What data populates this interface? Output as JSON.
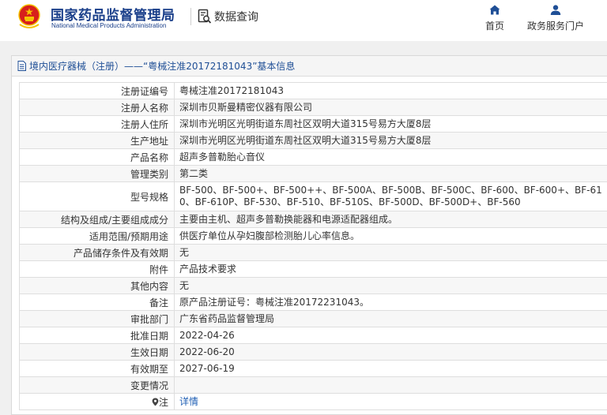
{
  "header": {
    "site_title_cn": "国家药品监督管理局",
    "site_title_en": "National Medical Products Administration",
    "data_query_label": "数据查询",
    "nav": [
      {
        "label": "首页",
        "icon": "home-icon"
      },
      {
        "label": "政务服务门户",
        "icon": "user-icon"
      }
    ]
  },
  "panel": {
    "title": "境内医疗器械（注册）——“粤械注准20172181043”基本信息"
  },
  "record": {
    "reg_no": {
      "label": "注册证编号",
      "value": "粤械注准20172181043"
    },
    "registrant": {
      "label": "注册人名称",
      "value": "深圳市贝斯曼精密仪器有限公司"
    },
    "registrant_address": {
      "label": "注册人住所",
      "value": "深圳市光明区光明街道东周社区双明大道315号易方大厦8层"
    },
    "production_address": {
      "label": "生产地址",
      "value": "深圳市光明区光明街道东周社区双明大道315号易方大厦8层"
    },
    "product_name": {
      "label": "产品名称",
      "value": "超声多普勒胎心音仪"
    },
    "category": {
      "label": "管理类别",
      "value": "第二类"
    },
    "models": {
      "label": "型号规格",
      "value": "BF-500、BF-500+、BF-500++、BF-500A、BF-500B、BF-500C、BF-600、BF-600+、BF-610、BF-610P、BF-530、BF-510、BF-510S、BF-500D、BF-500D+、BF-560"
    },
    "composition": {
      "label": "结构及组成/主要组成成分",
      "value": "主要由主机、超声多普勒换能器和电源适配器组成。"
    },
    "scope": {
      "label": "适用范围/预期用途",
      "value": "供医疗单位从孕妇腹部检测胎儿心率信息。"
    },
    "storage": {
      "label": "产品储存条件及有效期",
      "value": "无"
    },
    "attachment": {
      "label": "附件",
      "value": "产品技术要求"
    },
    "other": {
      "label": "其他内容",
      "value": "无"
    },
    "remark": {
      "label": "备注",
      "value": "原产品注册证号：粤械注准20172231043。"
    },
    "approval_dept": {
      "label": "审批部门",
      "value": "广东省药品监督管理局"
    },
    "approval_date": {
      "label": "批准日期",
      "value": "2022-04-26"
    },
    "effective_date": {
      "label": "生效日期",
      "value": "2022-06-20"
    },
    "expiry_date": {
      "label": "有效期至",
      "value": "2027-06-19"
    },
    "change": {
      "label": "变更情况",
      "value": ""
    },
    "note": {
      "label": "注",
      "value": "详情"
    }
  },
  "colors": {
    "brand_blue": "#1a3f8a",
    "emblem_red": "#d7201b",
    "emblem_gold": "#f5c400",
    "link_blue": "#1f5fb4"
  }
}
